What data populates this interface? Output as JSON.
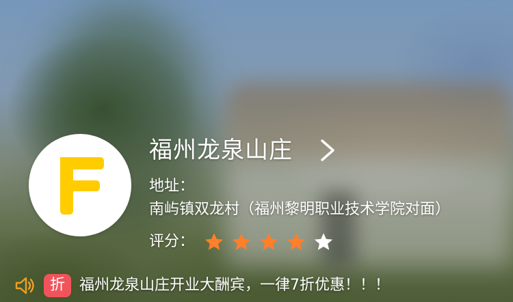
{
  "store": {
    "name": "福州龙泉山庄",
    "address_label": "地址：",
    "address": "南屿镇双龙村（福州黎明职业技术学院对面）",
    "logo_letter": "F",
    "logo_color": "#ffcc00"
  },
  "rating": {
    "label": "评分：",
    "value": 4,
    "max": 5,
    "filled_color": "#ff7f2a",
    "empty_color": "#ffffff"
  },
  "notice": {
    "badge": "折",
    "badge_color": "#f0545a",
    "text": "福州龙泉山庄开业大酬宾，一律7折优惠！！！",
    "icon": "speaker-icon"
  },
  "icons": {
    "chevron": "chevron-right-icon",
    "star": "star-icon"
  }
}
